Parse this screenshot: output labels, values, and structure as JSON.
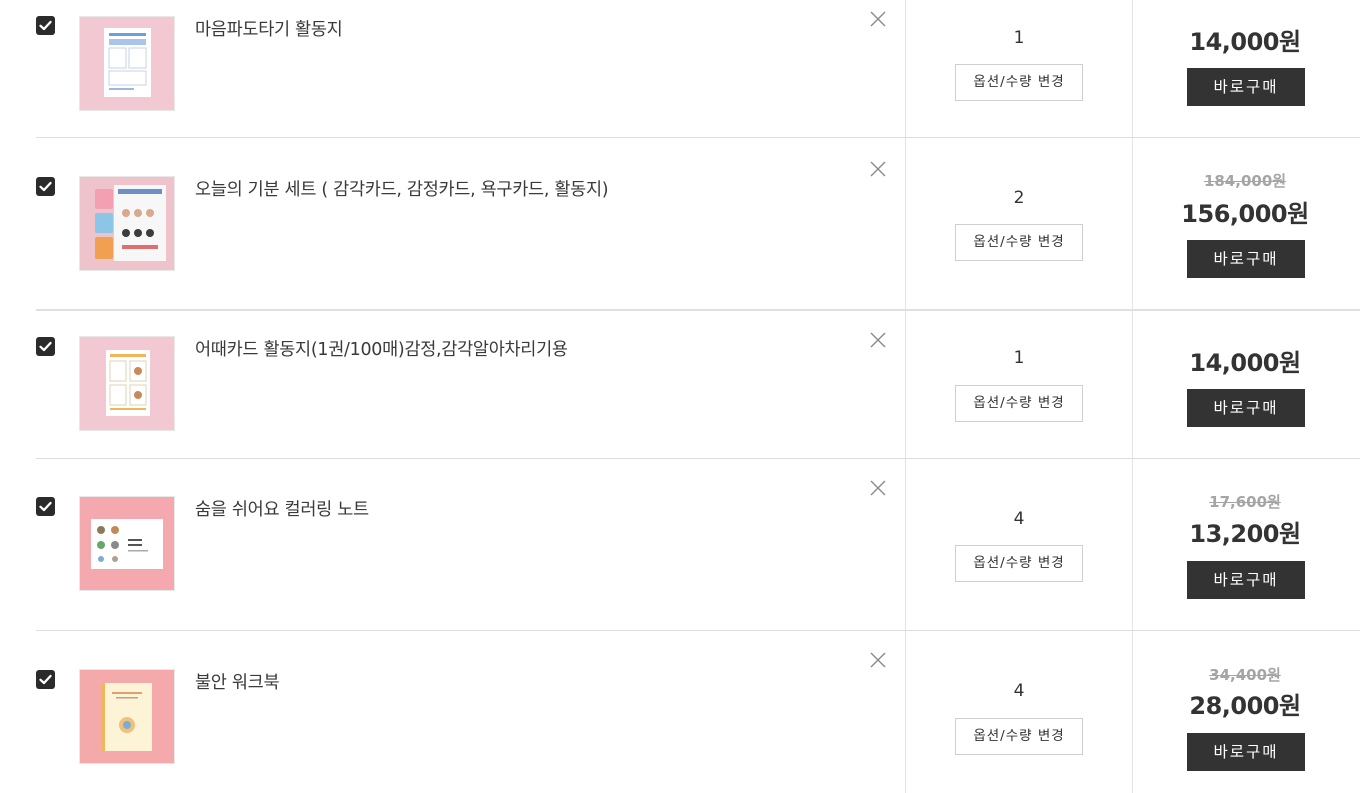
{
  "cart": {
    "items": [
      {
        "checked": true,
        "name": "마음파도타기 활동지",
        "quantity": "1",
        "option_button": "옵션/수량 변경",
        "original_price": "",
        "price": "14,000원",
        "buy_button": "바로구매",
        "thumb_bg": "#f2c9d2",
        "thumb_icon": "worksheet-thumbnail"
      },
      {
        "checked": true,
        "name": "오늘의 기분 세트 ( 감각카드, 감정카드, 욕구카드, 활동지)",
        "quantity": "2",
        "option_button": "옵션/수량 변경",
        "original_price": "184,000원",
        "price": "156,000원",
        "buy_button": "바로구매",
        "thumb_bg": "#efc3cc",
        "thumb_icon": "card-set-thumbnail"
      },
      {
        "checked": true,
        "name": "어때카드 활동지(1권/100매)감정,감각알아차리기용",
        "quantity": "1",
        "option_button": "옵션/수량 변경",
        "original_price": "",
        "price": "14,000원",
        "buy_button": "바로구매",
        "thumb_bg": "#f2c9d2",
        "thumb_icon": "worksheet-thumbnail"
      },
      {
        "checked": true,
        "name": "숨을 쉬어요 컬러링 노트",
        "quantity": "4",
        "option_button": "옵션/수량 변경",
        "original_price": "17,600원",
        "price": "13,200원",
        "buy_button": "바로구매",
        "thumb_bg": "#f3a9ad",
        "thumb_icon": "coloring-note-thumbnail"
      },
      {
        "checked": true,
        "name": "불안 워크북",
        "quantity": "4",
        "option_button": "옵션/수량 변경",
        "original_price": "34,400원",
        "price": "28,000원",
        "buy_button": "바로구매",
        "thumb_bg": "#f4a9ab",
        "thumb_icon": "workbook-thumbnail"
      }
    ]
  },
  "colors": {
    "button_dark": "#333333",
    "checkbox": "#2b2b2b",
    "strike_price": "#a5a5a5",
    "divider": "#e4e4e4"
  },
  "icons": {
    "checkbox": "checkbox-checked-icon",
    "remove": "close-icon"
  }
}
